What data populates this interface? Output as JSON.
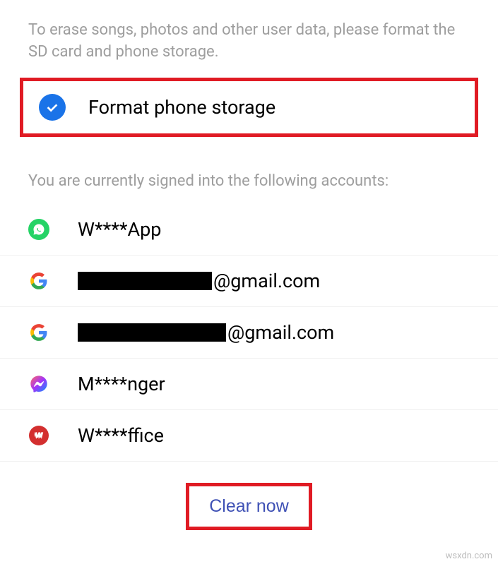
{
  "description": "To erase songs, photos and other user data, please format the SD card and phone storage.",
  "format_option": {
    "label": "Format phone storage",
    "checked": true
  },
  "accounts_header": "You are currently signed into the following accounts:",
  "accounts": [
    {
      "icon": "whatsapp",
      "label": "W****App",
      "redacted": false
    },
    {
      "icon": "google",
      "label": "@gmail.com",
      "redacted": true,
      "redacted_width": 190
    },
    {
      "icon": "google",
      "label": "@gmail.com",
      "redacted": true,
      "redacted_width": 210
    },
    {
      "icon": "messenger",
      "label": "M****nger",
      "redacted": false
    },
    {
      "icon": "wps",
      "label": "W****ffice",
      "redacted": false
    }
  ],
  "clear_button": "Clear now",
  "watermark": "wsxdn.com"
}
